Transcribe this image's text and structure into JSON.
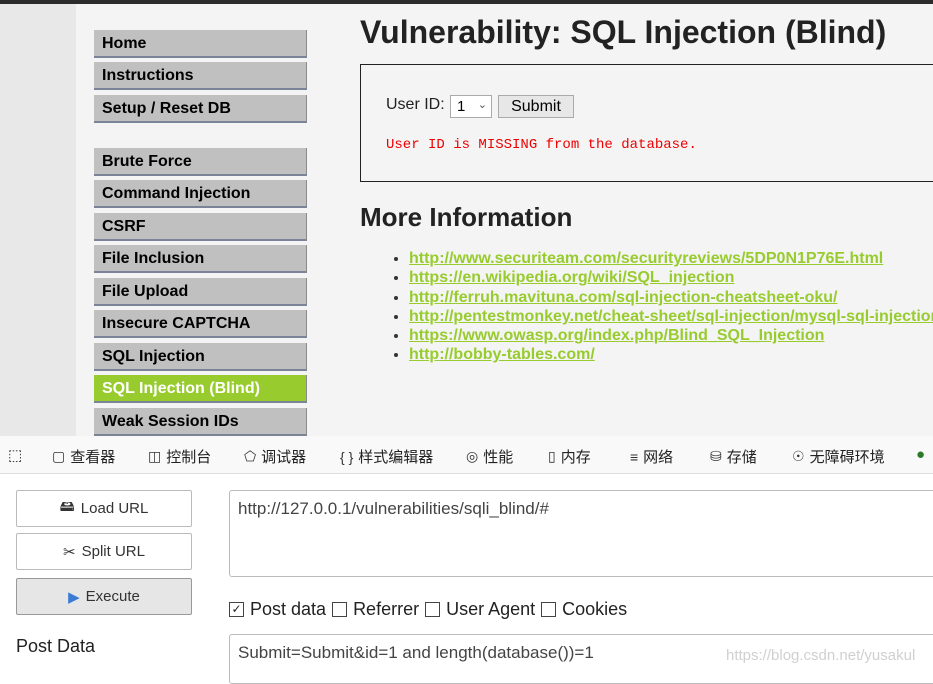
{
  "dvwa": {
    "title": "Vulnerability: SQL Injection (Blind)",
    "nav_top": [
      "Home",
      "Instructions",
      "Setup / Reset DB"
    ],
    "nav_vulns": [
      "Brute Force",
      "Command Injection",
      "CSRF",
      "File Inclusion",
      "File Upload",
      "Insecure CAPTCHA",
      "SQL Injection",
      "SQL Injection (Blind)",
      "Weak Session IDs"
    ],
    "active_item": "SQL Injection (Blind)",
    "form": {
      "label": "User ID:",
      "selected": "1",
      "submit": "Submit",
      "message": "User ID is MISSING from the database."
    },
    "more_info_title": "More Information",
    "links": [
      "http://www.securiteam.com/securityreviews/5DP0N1P76E.html",
      "https://en.wikipedia.org/wiki/SQL_injection",
      "http://ferruh.mavituna.com/sql-injection-cheatsheet-oku/",
      "http://pentestmonkey.net/cheat-sheet/sql-injection/mysql-sql-injection-cheat-sheet",
      "https://www.owasp.org/index.php/Blind_SQL_Injection",
      "http://bobby-tables.com/"
    ],
    "accent": "#98cc2e"
  },
  "devtools": {
    "tabs": [
      {
        "icon": "inspector-icon",
        "label": "查看器"
      },
      {
        "icon": "console-icon",
        "label": "控制台"
      },
      {
        "icon": "debugger-icon",
        "label": "调试器"
      },
      {
        "icon": "style-editor-icon",
        "label": "样式编辑器"
      },
      {
        "icon": "performance-icon",
        "label": "性能"
      },
      {
        "icon": "memory-icon",
        "label": "内存"
      },
      {
        "icon": "network-icon",
        "label": "网络"
      },
      {
        "icon": "storage-icon",
        "label": "存储"
      },
      {
        "icon": "accessibility-icon",
        "label": "无障碍环境"
      }
    ]
  },
  "hackbar": {
    "load_url": "Load URL",
    "split_url": "Split URL",
    "execute": "Execute",
    "url": "http://127.0.0.1/vulnerabilities/sqli_blind/#",
    "checks": [
      {
        "label": "Post data",
        "checked": true
      },
      {
        "label": "Referrer",
        "checked": false
      },
      {
        "label": "User Agent",
        "checked": false
      },
      {
        "label": "Cookies",
        "checked": false
      }
    ],
    "post_data_label": "Post Data",
    "post_data": "Submit=Submit&id=1 and length(database())=1"
  },
  "watermark": "https://blog.csdn.net/yusakul"
}
